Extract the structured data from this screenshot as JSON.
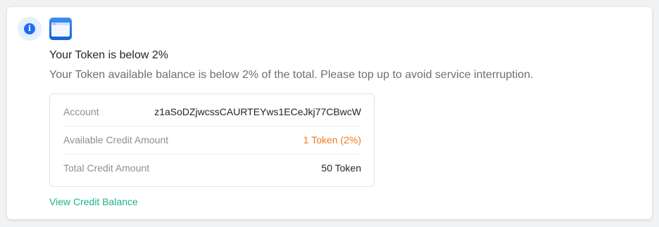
{
  "notification": {
    "title": "Your Token is below 2%",
    "message": "Your Token available balance is below 2% of the total. Please top up to avoid service interruption.",
    "status_icon": "info-icon",
    "status_icon_glyph": "i",
    "app_icon": "app-window-icon",
    "details": [
      {
        "label": "Account",
        "value": "z1aSoDZjwcssCAURTEYws1ECeJkj77CBwcW"
      },
      {
        "label": "Available Credit Amount",
        "value": "1 Token (2%)"
      },
      {
        "label": "Total Credit Amount",
        "value": "50 Token"
      }
    ],
    "link_label": "View Credit Balance"
  },
  "colors": {
    "info_blue": "#1f6ef0",
    "warning_orange": "#f07a1a",
    "link_green": "#1bb28c"
  }
}
